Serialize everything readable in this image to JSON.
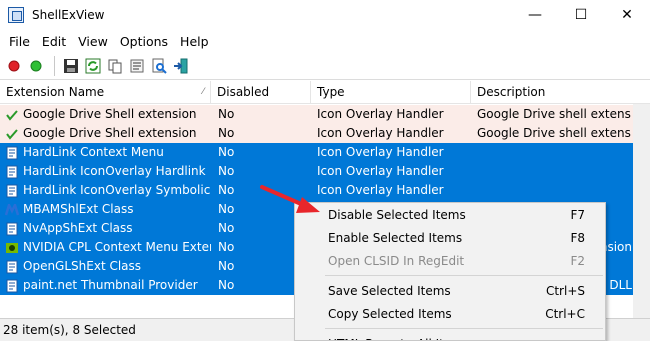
{
  "window": {
    "title": "ShellExView",
    "min": "—",
    "max": "☐",
    "close": "✕"
  },
  "menu": [
    "File",
    "Edit",
    "View",
    "Options",
    "Help"
  ],
  "columns": [
    "Extension Name",
    "Disabled",
    "Type",
    "Description"
  ],
  "rows": [
    {
      "name": "Google Drive Shell extension",
      "disabled": "No",
      "type": "Icon Overlay Handler",
      "desc": "Google Drive shell extension",
      "icon": "check-icon",
      "state": "pink"
    },
    {
      "name": "Google Drive Shell extension",
      "disabled": "No",
      "type": "Icon Overlay Handler",
      "desc": "Google Drive shell extension",
      "icon": "check-icon",
      "state": "pink"
    },
    {
      "name": "HardLink Context Menu",
      "disabled": "No",
      "type": "Icon Overlay Handler",
      "desc": "",
      "icon": "doc-icon",
      "state": "sel"
    },
    {
      "name": "HardLink IconOverlay Hardlink",
      "disabled": "No",
      "type": "Icon Overlay Handler",
      "desc": "",
      "icon": "doc-icon",
      "state": "sel"
    },
    {
      "name": "HardLink IconOverlay SymbolicLi...",
      "disabled": "No",
      "type": "Icon Overlay Handler",
      "desc": "",
      "icon": "doc-icon",
      "state": "sel"
    },
    {
      "name": "MBAMShlExt Class",
      "disabled": "No",
      "type": "",
      "desc": "",
      "icon": "malwarebytes-icon",
      "state": "sel"
    },
    {
      "name": "NvAppShExt Class",
      "disabled": "No",
      "type": "",
      "desc": "",
      "icon": "doc-icon",
      "state": "sel"
    },
    {
      "name": "NVIDIA CPL Context Menu Exten...",
      "disabled": "No",
      "type": "",
      "desc": "ension",
      "icon": "nvidia-icon",
      "state": "sel"
    },
    {
      "name": "OpenGLShExt Class",
      "disabled": "No",
      "type": "",
      "desc": "",
      "icon": "doc-icon",
      "state": "sel"
    },
    {
      "name": "paint.net Thumbnail Provider",
      "disabled": "No",
      "type": "",
      "desc": "DLL",
      "icon": "doc-icon",
      "state": "sel"
    }
  ],
  "status": "28 item(s), 8 Selected",
  "context_menu": [
    {
      "label": "Disable Selected Items",
      "shortcut": "F7",
      "enabled": true
    },
    {
      "label": "Enable Selected Items",
      "shortcut": "F8",
      "enabled": true
    },
    {
      "label": "Open CLSID In RegEdit",
      "shortcut": "F2",
      "enabled": false
    },
    {
      "sep": true
    },
    {
      "label": "Save Selected Items",
      "shortcut": "Ctrl+S",
      "enabled": true
    },
    {
      "label": "Copy Selected Items",
      "shortcut": "Ctrl+C",
      "enabled": true
    },
    {
      "sep": true
    },
    {
      "label": "HTML Report - All Items",
      "shortcut": "",
      "enabled": true
    }
  ],
  "colors": {
    "selection": "#0078d7",
    "highlight_row": "#fbece8",
    "arrow": "#e8262b"
  }
}
